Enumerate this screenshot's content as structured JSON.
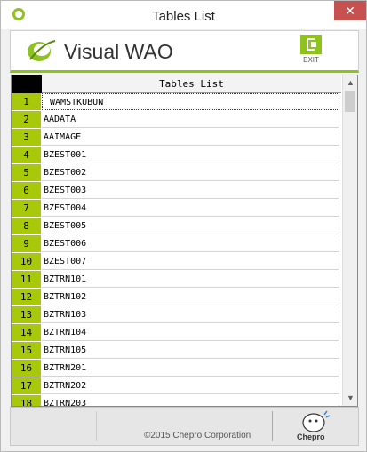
{
  "window": {
    "title": "Tables List",
    "close_glyph": "✕"
  },
  "header": {
    "logo_text": "Visual WAO",
    "exit_label": "EXIT"
  },
  "grid": {
    "column_header": "Tables List",
    "rows": [
      {
        "num": "1",
        "name": "_WAMSTKUBUN"
      },
      {
        "num": "2",
        "name": "AADATA"
      },
      {
        "num": "3",
        "name": "AAIMAGE"
      },
      {
        "num": "4",
        "name": "BZEST001"
      },
      {
        "num": "5",
        "name": "BZEST002"
      },
      {
        "num": "6",
        "name": "BZEST003"
      },
      {
        "num": "7",
        "name": "BZEST004"
      },
      {
        "num": "8",
        "name": "BZEST005"
      },
      {
        "num": "9",
        "name": "BZEST006"
      },
      {
        "num": "10",
        "name": "BZEST007"
      },
      {
        "num": "11",
        "name": "BZTRN101"
      },
      {
        "num": "12",
        "name": "BZTRN102"
      },
      {
        "num": "13",
        "name": "BZTRN103"
      },
      {
        "num": "14",
        "name": "BZTRN104"
      },
      {
        "num": "15",
        "name": "BZTRN105"
      },
      {
        "num": "16",
        "name": "BZTRN201"
      },
      {
        "num": "17",
        "name": "BZTRN202"
      },
      {
        "num": "18",
        "name": "BZTRN203"
      }
    ]
  },
  "footer": {
    "copyright": "©2015 Chepro Corporation",
    "brand": "Chepro"
  },
  "colors": {
    "accent": "#8dc21f",
    "rownum_bg": "#a8c80a",
    "close": "#c75050"
  }
}
